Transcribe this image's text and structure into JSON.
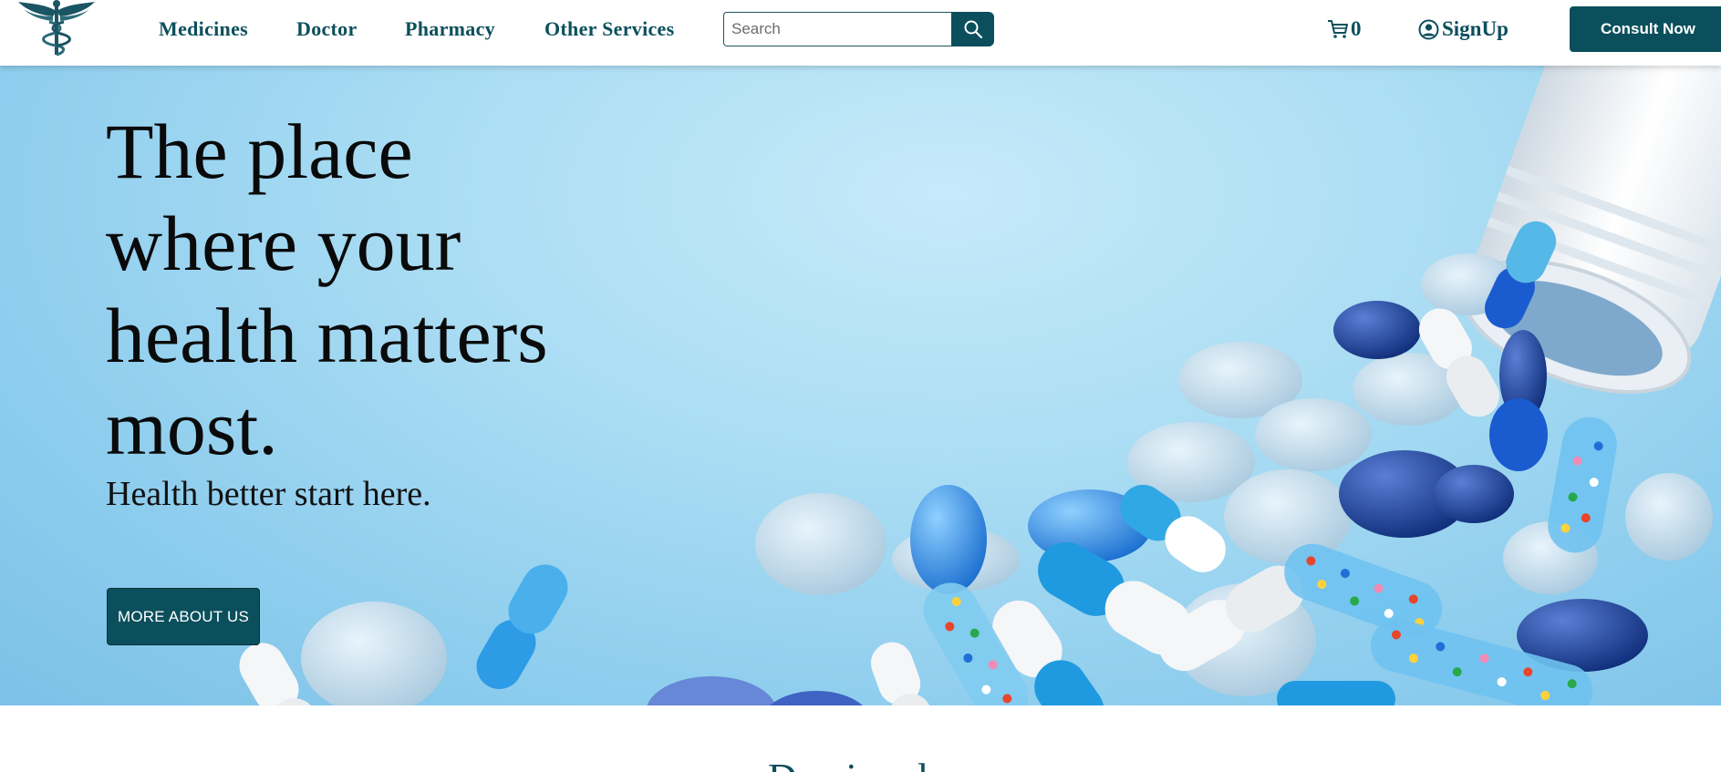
{
  "header": {
    "nav": [
      "Medicines",
      "Doctor",
      "Pharmacy",
      "Other Services"
    ],
    "search": {
      "placeholder": "Search",
      "value": ""
    },
    "cart_count": "0",
    "signup_label": "SignUp",
    "consult_label": "Consult Now"
  },
  "hero": {
    "title_lines": [
      "The place",
      "where your",
      "health matters",
      "most."
    ],
    "subtitle": "Health better start here.",
    "cta_label": "MORE ABOUT US"
  },
  "section": {
    "partial_heading": "Dowion d"
  },
  "icons": {
    "logo": "caduceus-logo-icon",
    "search": "search-icon",
    "cart": "cart-icon",
    "user": "user-circle-icon"
  },
  "colors": {
    "brand": "#0b4f5c",
    "hero_background": "#a9dcf3",
    "text_dark": "#0a0a0a",
    "white": "#ffffff"
  }
}
